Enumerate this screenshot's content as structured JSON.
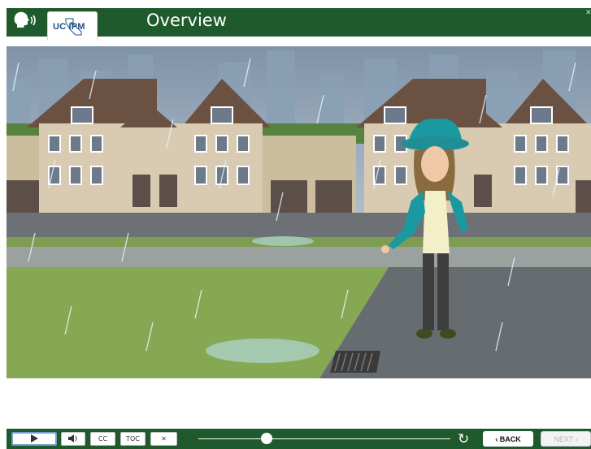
{
  "header": {
    "title": "Overview",
    "logo_text": "UC IPM",
    "speech_icon": "speaking-head-icon",
    "close_icon": "close-icon"
  },
  "scene": {
    "description_icon": "illustration"
  },
  "controls": {
    "play_icon": "play-icon",
    "volume_icon": "volume-icon",
    "cc_label": "CC",
    "toc_label": "TOC",
    "close_label": "✕",
    "progress": 0.27,
    "reload_icon": "reload-icon",
    "back_label": "‹ BACK",
    "next_label": "NEXT ›"
  },
  "colors": {
    "header_bg": "#1f5a2c",
    "controls_bg": "#1f5a2c",
    "grass": "#88a957",
    "street": "#666b6f"
  }
}
